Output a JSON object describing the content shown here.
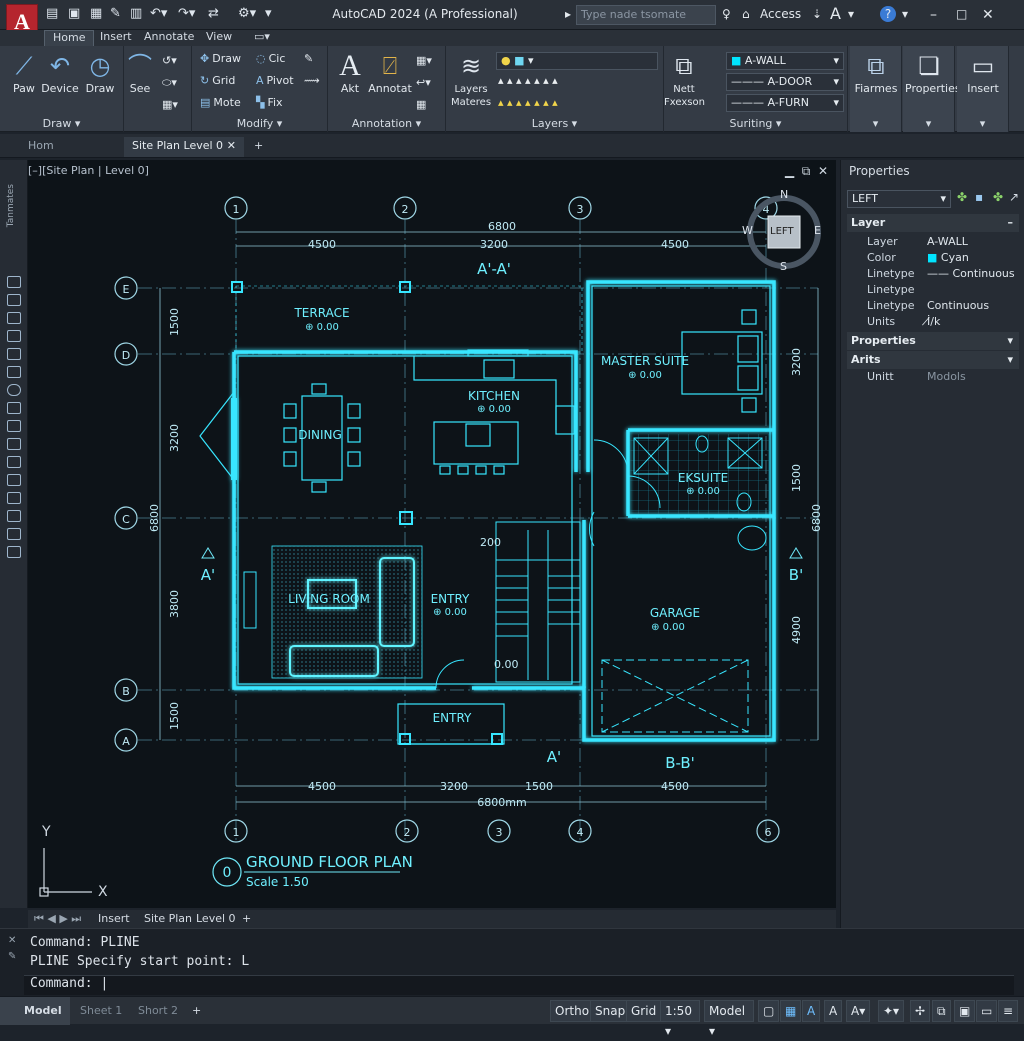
{
  "titlebar": {
    "app_title": "AutoCAD 2024 (A Professional)",
    "search_placeholder": "Type nade tsomate",
    "access": "Access",
    "logo": "A"
  },
  "ribbon_tabs": [
    "Home",
    "Insert",
    "Annotate",
    "View"
  ],
  "ribbon": {
    "draw_panel": {
      "label": "Draw",
      "big": [
        "Paw",
        "Device",
        "Draw",
        "See"
      ]
    },
    "modify_panel": {
      "label": "Modify",
      "items": [
        "Draw",
        "Cic",
        "Grid",
        "Pivot",
        "Mote",
        "Fix"
      ]
    },
    "annotation_panel": {
      "label": "Annotation",
      "big": [
        "Akt",
        "Annotat"
      ]
    },
    "layers_panel": {
      "label": "Layers",
      "big": "Layers Materes"
    },
    "surface_panel": {
      "label": "Suriting",
      "big": "Nett Fxexson",
      "layers": [
        "A-WALL",
        "A-DOOR",
        "A-FURN"
      ]
    },
    "right_buttons": [
      "Fiarmes",
      "Properties",
      "Insert"
    ]
  },
  "doc_tabs": {
    "home": "Hom",
    "active": "Site Plan Level 0"
  },
  "viewport": {
    "label": "[–][Site Plan | Level 0]",
    "viewcube_face": "LEFT",
    "compass": {
      "n": "N",
      "s": "S",
      "e": "E",
      "w": "W"
    },
    "left_label": "Tanmates"
  },
  "plan": {
    "grid_top": [
      "1",
      "2",
      "3",
      "4"
    ],
    "grid_bottom": [
      "1",
      "2",
      "3",
      "4",
      "6"
    ],
    "grid_left": [
      "E",
      "D",
      "C",
      "B",
      "A"
    ],
    "dims_top": {
      "overall": "6800",
      "parts": [
        "4500",
        "3200",
        "4500"
      ]
    },
    "dims_bottom": {
      "overall": "6800mm",
      "parts": [
        "4500",
        "3200",
        "1500",
        "4500"
      ]
    },
    "dims_left": [
      "1500",
      "3200",
      "6800",
      "3800",
      "1500"
    ],
    "dims_right": [
      "3200",
      "1500",
      "6800",
      "4900"
    ],
    "rooms": [
      {
        "name": "TERRACE",
        "level": "⊕ 0.00"
      },
      {
        "name": "KITCHEN",
        "level": "⊕ 0.00"
      },
      {
        "name": "MASTER SUITE",
        "level": "⊕ 0.00"
      },
      {
        "name": "DINING",
        "level": ""
      },
      {
        "name": "EKSUITE",
        "level": "⊕ 0.00"
      },
      {
        "name": "LIVING ROOM",
        "level": ""
      },
      {
        "name": "ENTRY",
        "level": "⊕ 0.00"
      },
      {
        "name": "GARAGE",
        "level": "⊕ 0.00"
      },
      {
        "name": "ENTRY",
        "level": ""
      }
    ],
    "sections": [
      "A'-A'",
      "A'",
      "A'",
      "B'",
      "B-B'"
    ],
    "stair_labels": [
      "200",
      "0.00"
    ],
    "plan_title": "GROUND FLOOR PLAN",
    "plan_scale": "Scale 1.50",
    "plan_marker": "0"
  },
  "properties": {
    "title": "Properties",
    "selector": "LEFT",
    "layer_section": "Layer",
    "rows": [
      {
        "k": "Layer",
        "v": "A-WALL"
      },
      {
        "k": "Color",
        "v": "Cyan"
      },
      {
        "k": "Linetype",
        "v": "Continuous"
      },
      {
        "k": "Linetype",
        "v": ""
      },
      {
        "k": "Linetype",
        "v": "Continuous"
      },
      {
        "k": "Units",
        "v": "İ̸/k"
      }
    ],
    "properties_section": "Properties",
    "arts_section": "Arits",
    "unit_row": {
      "k": "Unitt",
      "v": "Modols"
    },
    "accent_cyan": "#00e5ff"
  },
  "layout_tabs": [
    "Insert",
    "Site Plan",
    "Level 0"
  ],
  "command": {
    "lines": [
      "Command: PLINE",
      "PLINE Specify start point: L"
    ],
    "prompt": "Command:"
  },
  "status": {
    "tabs": [
      "Model",
      "Sheet 1",
      "Short 2"
    ],
    "buttons": [
      "Ortho",
      "Snap",
      "Grid",
      "1:50",
      "Model"
    ]
  }
}
